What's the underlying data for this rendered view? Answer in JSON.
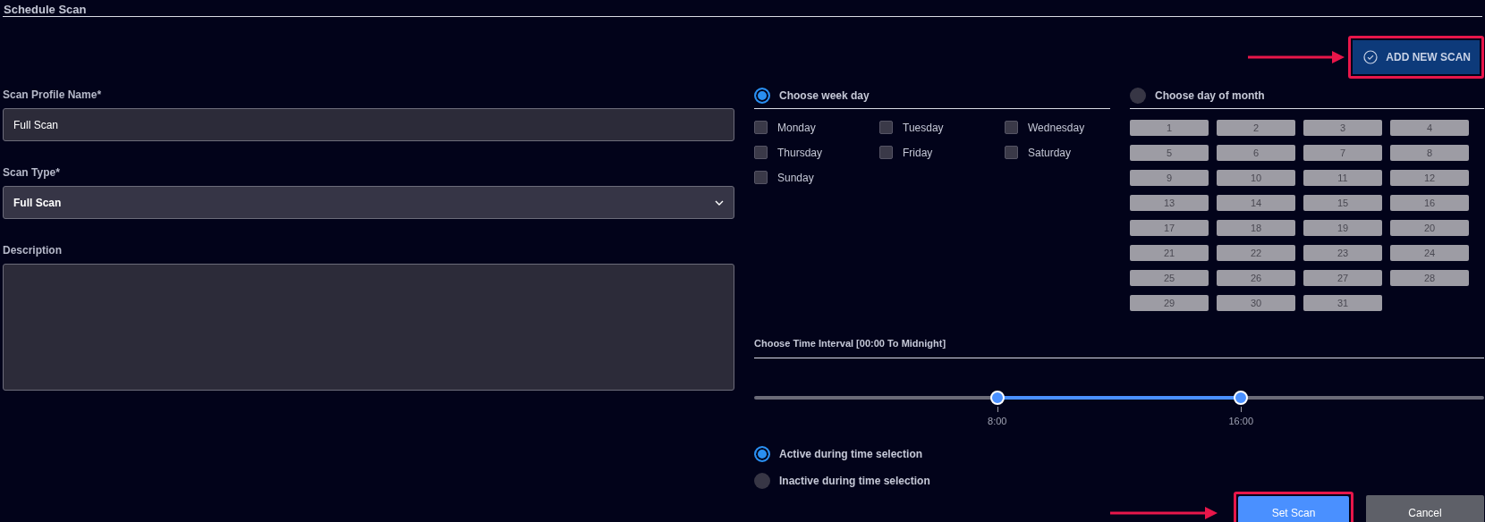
{
  "title": "Schedule Scan",
  "add_button": {
    "label": "ADD NEW SCAN",
    "highlighted": true
  },
  "form": {
    "profile_name": {
      "label": "Scan Profile Name*",
      "value": "Full Scan"
    },
    "scan_type": {
      "label": "Scan Type*",
      "value": "Full Scan"
    },
    "description": {
      "label": "Description"
    }
  },
  "week_day": {
    "label": "Choose week day",
    "selected": true,
    "days": [
      {
        "label": "Monday",
        "checked": false
      },
      {
        "label": "Tuesday",
        "checked": false
      },
      {
        "label": "Wednesday",
        "checked": false
      },
      {
        "label": "Thursday",
        "checked": false
      },
      {
        "label": "Friday",
        "checked": false
      },
      {
        "label": "Saturday",
        "checked": false
      },
      {
        "label": "Sunday",
        "checked": false
      }
    ]
  },
  "month_day": {
    "label": "Choose day of month",
    "selected": false,
    "days": [
      "1",
      "2",
      "3",
      "4",
      "5",
      "6",
      "7",
      "8",
      "9",
      "10",
      "11",
      "12",
      "13",
      "14",
      "15",
      "16",
      "17",
      "18",
      "19",
      "20",
      "21",
      "22",
      "23",
      "24",
      "25",
      "26",
      "27",
      "28",
      "29",
      "30",
      "31"
    ]
  },
  "time_interval": {
    "label": "Choose Time Interval [00:00 To Midnight]",
    "thumbs": [
      {
        "label": "8:00",
        "level": 0.333
      },
      {
        "label": "16:00",
        "level": 0.667
      }
    ],
    "options": [
      {
        "label": "Active during time selection",
        "selected": true
      },
      {
        "label": "Inactive during time selection",
        "selected": false
      }
    ]
  },
  "buttons": [
    {
      "kind": "primary",
      "label": "Set Scan",
      "highlighted": true
    },
    {
      "kind": "secondary",
      "label": "Cancel",
      "highlighted": false
    }
  ]
}
